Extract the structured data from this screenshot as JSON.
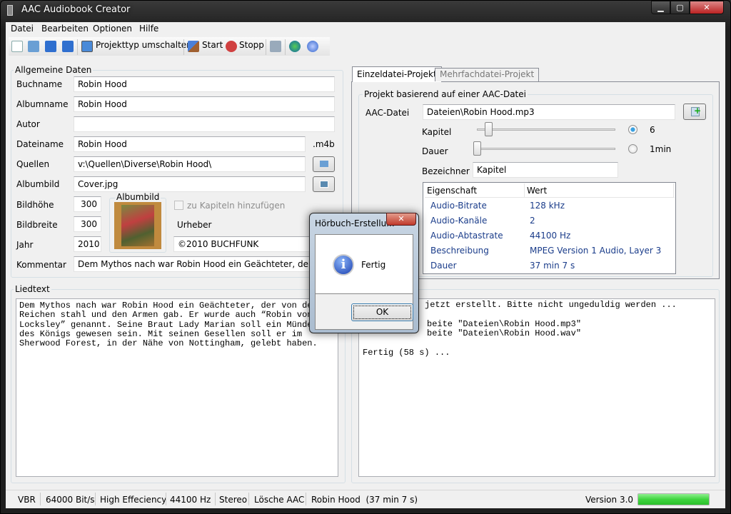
{
  "window": {
    "title": "AAC Audiobook Creator",
    "min": "▁",
    "max": "▢",
    "close": "✕"
  },
  "menu": [
    "Datei",
    "Bearbeiten",
    "Optionen",
    "Hilfe"
  ],
  "toolbar": {
    "switch": "Projekttyp umschalten",
    "start": "Start",
    "stop": "Stopp"
  },
  "general": {
    "title": "Allgemeine Daten",
    "labels": {
      "book": "Buchname",
      "album": "Albumname",
      "author": "Autor",
      "file": "Dateiname",
      "sources": "Quellen",
      "cover": "Albumbild",
      "height": "Bildhöhe",
      "width": "Bildbreite",
      "year": "Jahr",
      "comment": "Kommentar",
      "copyright": "Urheber"
    },
    "values": {
      "book": "Robin Hood",
      "album": "Robin Hood",
      "author": "",
      "file": "Robin Hood",
      "sources": "v:\\Quellen\\Diverse\\Robin Hood\\",
      "cover": "Cover.jpg",
      "height": "300",
      "width": "300",
      "year": "2010",
      "comment": "Dem Mythos nach war Robin Hood ein Geächteter, der von den",
      "copyright": "©2010 BUCHFUNK"
    },
    "ext": ".m4b",
    "cover_group": "Albumbild",
    "add_to_chapters": "zu Kapiteln hinzufügen"
  },
  "lyrics": {
    "title": "Liedtext",
    "text": "Dem Mythos nach war Robin Hood ein Geächteter, der von den\nReichen stahl und den Armen gab. Er wurde auch “Robin von\nLocksley” genannt. Seine Braut Lady Marian soll ein Mündel\ndes Königs gewesen sein. Mit seinen Gesellen soll er im\nSherwood Forest, in der Nähe von Nottingham, gelebt haben."
  },
  "tabs": [
    {
      "label": "Einzeldatei-Projekt",
      "active": true
    },
    {
      "label": "Mehrfachdatei-Projekt",
      "active": false
    }
  ],
  "project": {
    "title": "Projekt basierend auf einer AAC-Datei",
    "file_label": "AAC-Datei",
    "file": "Dateien\\Robin Hood.mp3",
    "chapter_label": "Kapitel",
    "chapter_value": "6",
    "chapter_selected": true,
    "duration_label": "Dauer",
    "duration_value": "1min",
    "duration_selected": false,
    "name_label": "Bezeichner",
    "name": "Kapitel",
    "columns": [
      "Eigenschaft",
      "Wert"
    ],
    "rows": [
      [
        "Audio-Bitrate",
        "128 kHz"
      ],
      [
        "Audio-Kanäle",
        "2"
      ],
      [
        "Audio-Abtastrate",
        "44100 Hz"
      ],
      [
        "Beschreibung",
        "MPEG Version 1 Audio, Layer 3"
      ],
      [
        "Dauer",
        "37 min 7 s"
      ]
    ]
  },
  "log": {
    "lines": [
      "jetzt erstellt. Bitte nicht ungeduldig werden ...",
      "beite \"Dateien\\Robin Hood.mp3\"",
      "beite \"Dateien\\Robin Hood.wav\"",
      "Fertig (58 s) ..."
    ]
  },
  "status": {
    "items": [
      "VBR",
      "64000 Bit/s",
      "High Effeciency",
      "44100 Hz",
      "Stereo",
      "Lösche AAC",
      "Robin Hood  (37 min 7 s)"
    ],
    "version": "Version 3.0",
    "progress": 100,
    "progress_color": "#3fd43f"
  },
  "dialog": {
    "title": "Hörbuch-Erstellu...",
    "message": "Fertig",
    "ok": "OK",
    "close": "✕"
  }
}
